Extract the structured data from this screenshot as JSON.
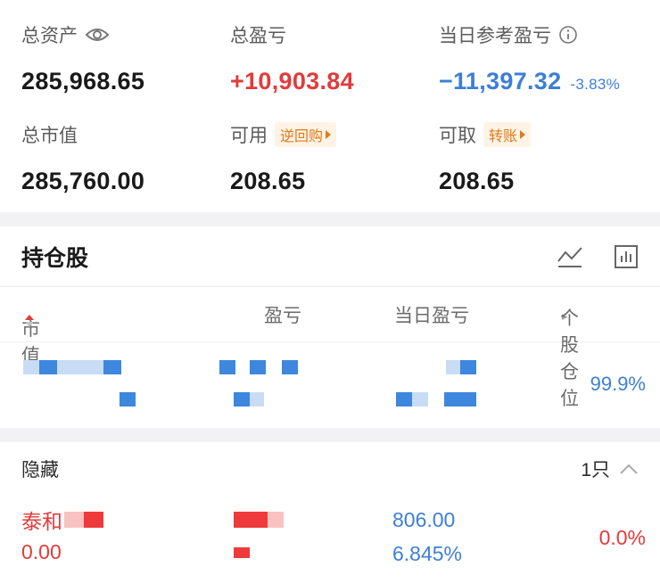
{
  "summary": {
    "total_assets_label": "总资产",
    "total_assets_value": "285,968.65",
    "total_pnl_label": "总盈亏",
    "total_pnl_value": "+10,903.84",
    "day_pnl_label": "当日参考盈亏",
    "day_pnl_value": "−11,397.32",
    "day_pnl_pct": "-3.83%",
    "market_value_label": "总市值",
    "market_value_value": "285,760.00",
    "available_label": "可用",
    "available_tag": "逆回购",
    "available_value": "208.65",
    "withdrawable_label": "可取",
    "withdrawable_tag": "转账",
    "withdrawable_value": "208.65"
  },
  "holdings": {
    "title": "持仓股",
    "columns": [
      "市值",
      "盈亏",
      "当日盈亏",
      "个股仓位"
    ],
    "row_position_pct": "99.9%"
  },
  "hidden": {
    "label": "隐藏",
    "count": "1只",
    "stock_name": "泰和",
    "market_value": "0.00",
    "pnl": "806.00",
    "pnl_pct": "6.845%",
    "position_pct": "0.0%"
  },
  "colors": {
    "up": "#e23b3b",
    "down": "#3d7fd6",
    "accent": "#e07a18"
  }
}
